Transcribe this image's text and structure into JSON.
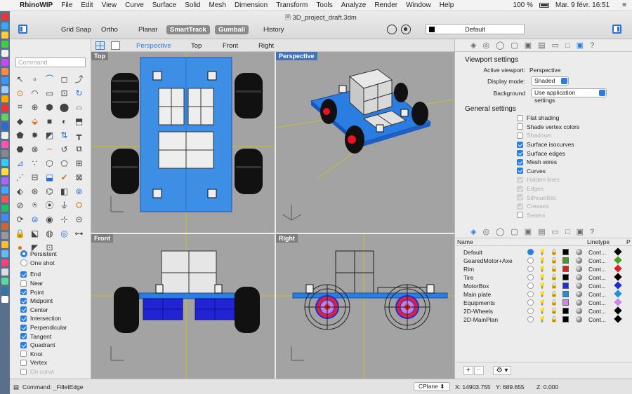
{
  "menubar": {
    "app": "RhinoWIP",
    "items": [
      "File",
      "Edit",
      "View",
      "Curve",
      "Surface",
      "Solid",
      "Mesh",
      "Dimension",
      "Transform",
      "Tools",
      "Analyze",
      "Render",
      "Window",
      "Help"
    ],
    "battery": "100 %",
    "clock": "Mar. 9 févr. 16:51"
  },
  "window": {
    "title": "3D_project_draft.3dm",
    "toolbar": [
      "Grid Snap",
      "Ortho",
      "Planar",
      "SmartTrack",
      "Gumball",
      "History"
    ],
    "active_toolbar": [
      "SmartTrack",
      "Gumball"
    ],
    "current_layer": "Default"
  },
  "command": {
    "placeholder": "Command"
  },
  "osnap": {
    "mode": [
      "Persistent",
      "One shot"
    ],
    "items": [
      {
        "label": "End",
        "checked": true,
        "enabled": true
      },
      {
        "label": "Near",
        "checked": false,
        "enabled": true
      },
      {
        "label": "Point",
        "checked": true,
        "enabled": true
      },
      {
        "label": "Midpoint",
        "checked": true,
        "enabled": true
      },
      {
        "label": "Center",
        "checked": true,
        "enabled": true
      },
      {
        "label": "Intersection",
        "checked": true,
        "enabled": true
      },
      {
        "label": "Perpendicular",
        "checked": true,
        "enabled": true
      },
      {
        "label": "Tangent",
        "checked": true,
        "enabled": true
      },
      {
        "label": "Quadrant",
        "checked": true,
        "enabled": true
      },
      {
        "label": "Knot",
        "checked": false,
        "enabled": true
      },
      {
        "label": "Vertex",
        "checked": false,
        "enabled": true
      },
      {
        "label": "On curve",
        "checked": false,
        "enabled": false
      }
    ]
  },
  "viewport_tabs": [
    "Perspective",
    "Top",
    "Front",
    "Right"
  ],
  "viewports": {
    "top": "Top",
    "perspective": "Perspective",
    "front": "Front",
    "right": "Right"
  },
  "viewport_properties": {
    "title": "Viewport settings",
    "active_label": "Active viewport:",
    "active_value": "Perspective",
    "display_label": "Display mode:",
    "display_value": "Shaded",
    "background_label": "Background",
    "background_value": "Use application settings",
    "general_title": "General settings",
    "options": [
      {
        "label": "Flat shading",
        "checked": false,
        "enabled": true
      },
      {
        "label": "Shade vertex colors",
        "checked": false,
        "enabled": true
      },
      {
        "label": "Shadows",
        "checked": false,
        "enabled": false
      },
      {
        "label": "Surface isocurves",
        "checked": true,
        "enabled": true
      },
      {
        "label": "Surface edges",
        "checked": true,
        "enabled": true
      },
      {
        "label": "Mesh wires",
        "checked": true,
        "enabled": true
      },
      {
        "label": "Curves",
        "checked": true,
        "enabled": true
      },
      {
        "label": "Hidden lines",
        "checked": true,
        "enabled": false
      },
      {
        "label": "Edges",
        "checked": true,
        "enabled": false
      },
      {
        "label": "Silhouettes",
        "checked": true,
        "enabled": false
      },
      {
        "label": "Creases",
        "checked": true,
        "enabled": false
      },
      {
        "label": "Seams",
        "checked": false,
        "enabled": false
      }
    ]
  },
  "layers": {
    "columns": {
      "name": "Name",
      "linetype": "Linetype",
      "print": "P"
    },
    "rows": [
      {
        "name": "Default",
        "current": true,
        "color": "#000000",
        "linetype": "Cont..."
      },
      {
        "name": "GearedMotor+Axe",
        "current": false,
        "color": "#4a9e1e",
        "linetype": "Cont..."
      },
      {
        "name": "Rim",
        "current": false,
        "color": "#e02020",
        "linetype": "Cont..."
      },
      {
        "name": "Tire",
        "current": false,
        "color": "#000000",
        "linetype": "Cont..."
      },
      {
        "name": "MotorBox",
        "current": false,
        "color": "#1a2fd6",
        "linetype": "Cont..."
      },
      {
        "name": "Main plate",
        "current": false,
        "color": "#1f8fe6",
        "linetype": "Cont..."
      },
      {
        "name": "Equipments",
        "current": false,
        "color": "#c98ae8",
        "linetype": "Cont..."
      },
      {
        "name": "2D-Wheels",
        "current": false,
        "color": "#000000",
        "linetype": "Cont..."
      },
      {
        "name": "2D-MainPlan",
        "current": false,
        "color": "#000000",
        "linetype": "Cont..."
      }
    ],
    "print_colors": [
      "#000000",
      "#4a9e1e",
      "#e02020",
      "#000000",
      "#1a2fd6",
      "#1f8fe6",
      "#c98ae8",
      "#000000",
      "#000000"
    ]
  },
  "status": {
    "command": "Command: _FilletEdge",
    "cplane": "CPlane",
    "x": "X: 14903.755",
    "y": "Y: 689.655",
    "z": "Z: 0.000"
  }
}
